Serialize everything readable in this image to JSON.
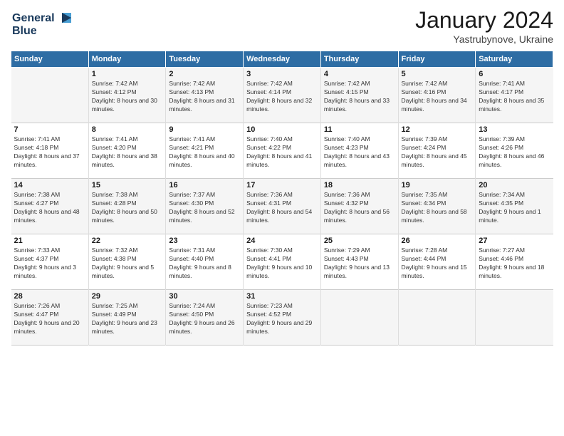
{
  "header": {
    "logo_line1": "General",
    "logo_line2": "Blue",
    "month": "January 2024",
    "location": "Yastrubynove, Ukraine"
  },
  "columns": [
    "Sunday",
    "Monday",
    "Tuesday",
    "Wednesday",
    "Thursday",
    "Friday",
    "Saturday"
  ],
  "weeks": [
    [
      {
        "day": "",
        "sunrise": "",
        "sunset": "",
        "daylight": ""
      },
      {
        "day": "1",
        "sunrise": "Sunrise: 7:42 AM",
        "sunset": "Sunset: 4:12 PM",
        "daylight": "Daylight: 8 hours and 30 minutes."
      },
      {
        "day": "2",
        "sunrise": "Sunrise: 7:42 AM",
        "sunset": "Sunset: 4:13 PM",
        "daylight": "Daylight: 8 hours and 31 minutes."
      },
      {
        "day": "3",
        "sunrise": "Sunrise: 7:42 AM",
        "sunset": "Sunset: 4:14 PM",
        "daylight": "Daylight: 8 hours and 32 minutes."
      },
      {
        "day": "4",
        "sunrise": "Sunrise: 7:42 AM",
        "sunset": "Sunset: 4:15 PM",
        "daylight": "Daylight: 8 hours and 33 minutes."
      },
      {
        "day": "5",
        "sunrise": "Sunrise: 7:42 AM",
        "sunset": "Sunset: 4:16 PM",
        "daylight": "Daylight: 8 hours and 34 minutes."
      },
      {
        "day": "6",
        "sunrise": "Sunrise: 7:41 AM",
        "sunset": "Sunset: 4:17 PM",
        "daylight": "Daylight: 8 hours and 35 minutes."
      }
    ],
    [
      {
        "day": "7",
        "sunrise": "Sunrise: 7:41 AM",
        "sunset": "Sunset: 4:18 PM",
        "daylight": "Daylight: 8 hours and 37 minutes."
      },
      {
        "day": "8",
        "sunrise": "Sunrise: 7:41 AM",
        "sunset": "Sunset: 4:20 PM",
        "daylight": "Daylight: 8 hours and 38 minutes."
      },
      {
        "day": "9",
        "sunrise": "Sunrise: 7:41 AM",
        "sunset": "Sunset: 4:21 PM",
        "daylight": "Daylight: 8 hours and 40 minutes."
      },
      {
        "day": "10",
        "sunrise": "Sunrise: 7:40 AM",
        "sunset": "Sunset: 4:22 PM",
        "daylight": "Daylight: 8 hours and 41 minutes."
      },
      {
        "day": "11",
        "sunrise": "Sunrise: 7:40 AM",
        "sunset": "Sunset: 4:23 PM",
        "daylight": "Daylight: 8 hours and 43 minutes."
      },
      {
        "day": "12",
        "sunrise": "Sunrise: 7:39 AM",
        "sunset": "Sunset: 4:24 PM",
        "daylight": "Daylight: 8 hours and 45 minutes."
      },
      {
        "day": "13",
        "sunrise": "Sunrise: 7:39 AM",
        "sunset": "Sunset: 4:26 PM",
        "daylight": "Daylight: 8 hours and 46 minutes."
      }
    ],
    [
      {
        "day": "14",
        "sunrise": "Sunrise: 7:38 AM",
        "sunset": "Sunset: 4:27 PM",
        "daylight": "Daylight: 8 hours and 48 minutes."
      },
      {
        "day": "15",
        "sunrise": "Sunrise: 7:38 AM",
        "sunset": "Sunset: 4:28 PM",
        "daylight": "Daylight: 8 hours and 50 minutes."
      },
      {
        "day": "16",
        "sunrise": "Sunrise: 7:37 AM",
        "sunset": "Sunset: 4:30 PM",
        "daylight": "Daylight: 8 hours and 52 minutes."
      },
      {
        "day": "17",
        "sunrise": "Sunrise: 7:36 AM",
        "sunset": "Sunset: 4:31 PM",
        "daylight": "Daylight: 8 hours and 54 minutes."
      },
      {
        "day": "18",
        "sunrise": "Sunrise: 7:36 AM",
        "sunset": "Sunset: 4:32 PM",
        "daylight": "Daylight: 8 hours and 56 minutes."
      },
      {
        "day": "19",
        "sunrise": "Sunrise: 7:35 AM",
        "sunset": "Sunset: 4:34 PM",
        "daylight": "Daylight: 8 hours and 58 minutes."
      },
      {
        "day": "20",
        "sunrise": "Sunrise: 7:34 AM",
        "sunset": "Sunset: 4:35 PM",
        "daylight": "Daylight: 9 hours and 1 minute."
      }
    ],
    [
      {
        "day": "21",
        "sunrise": "Sunrise: 7:33 AM",
        "sunset": "Sunset: 4:37 PM",
        "daylight": "Daylight: 9 hours and 3 minutes."
      },
      {
        "day": "22",
        "sunrise": "Sunrise: 7:32 AM",
        "sunset": "Sunset: 4:38 PM",
        "daylight": "Daylight: 9 hours and 5 minutes."
      },
      {
        "day": "23",
        "sunrise": "Sunrise: 7:31 AM",
        "sunset": "Sunset: 4:40 PM",
        "daylight": "Daylight: 9 hours and 8 minutes."
      },
      {
        "day": "24",
        "sunrise": "Sunrise: 7:30 AM",
        "sunset": "Sunset: 4:41 PM",
        "daylight": "Daylight: 9 hours and 10 minutes."
      },
      {
        "day": "25",
        "sunrise": "Sunrise: 7:29 AM",
        "sunset": "Sunset: 4:43 PM",
        "daylight": "Daylight: 9 hours and 13 minutes."
      },
      {
        "day": "26",
        "sunrise": "Sunrise: 7:28 AM",
        "sunset": "Sunset: 4:44 PM",
        "daylight": "Daylight: 9 hours and 15 minutes."
      },
      {
        "day": "27",
        "sunrise": "Sunrise: 7:27 AM",
        "sunset": "Sunset: 4:46 PM",
        "daylight": "Daylight: 9 hours and 18 minutes."
      }
    ],
    [
      {
        "day": "28",
        "sunrise": "Sunrise: 7:26 AM",
        "sunset": "Sunset: 4:47 PM",
        "daylight": "Daylight: 9 hours and 20 minutes."
      },
      {
        "day": "29",
        "sunrise": "Sunrise: 7:25 AM",
        "sunset": "Sunset: 4:49 PM",
        "daylight": "Daylight: 9 hours and 23 minutes."
      },
      {
        "day": "30",
        "sunrise": "Sunrise: 7:24 AM",
        "sunset": "Sunset: 4:50 PM",
        "daylight": "Daylight: 9 hours and 26 minutes."
      },
      {
        "day": "31",
        "sunrise": "Sunrise: 7:23 AM",
        "sunset": "Sunset: 4:52 PM",
        "daylight": "Daylight: 9 hours and 29 minutes."
      },
      {
        "day": "",
        "sunrise": "",
        "sunset": "",
        "daylight": ""
      },
      {
        "day": "",
        "sunrise": "",
        "sunset": "",
        "daylight": ""
      },
      {
        "day": "",
        "sunrise": "",
        "sunset": "",
        "daylight": ""
      }
    ]
  ]
}
